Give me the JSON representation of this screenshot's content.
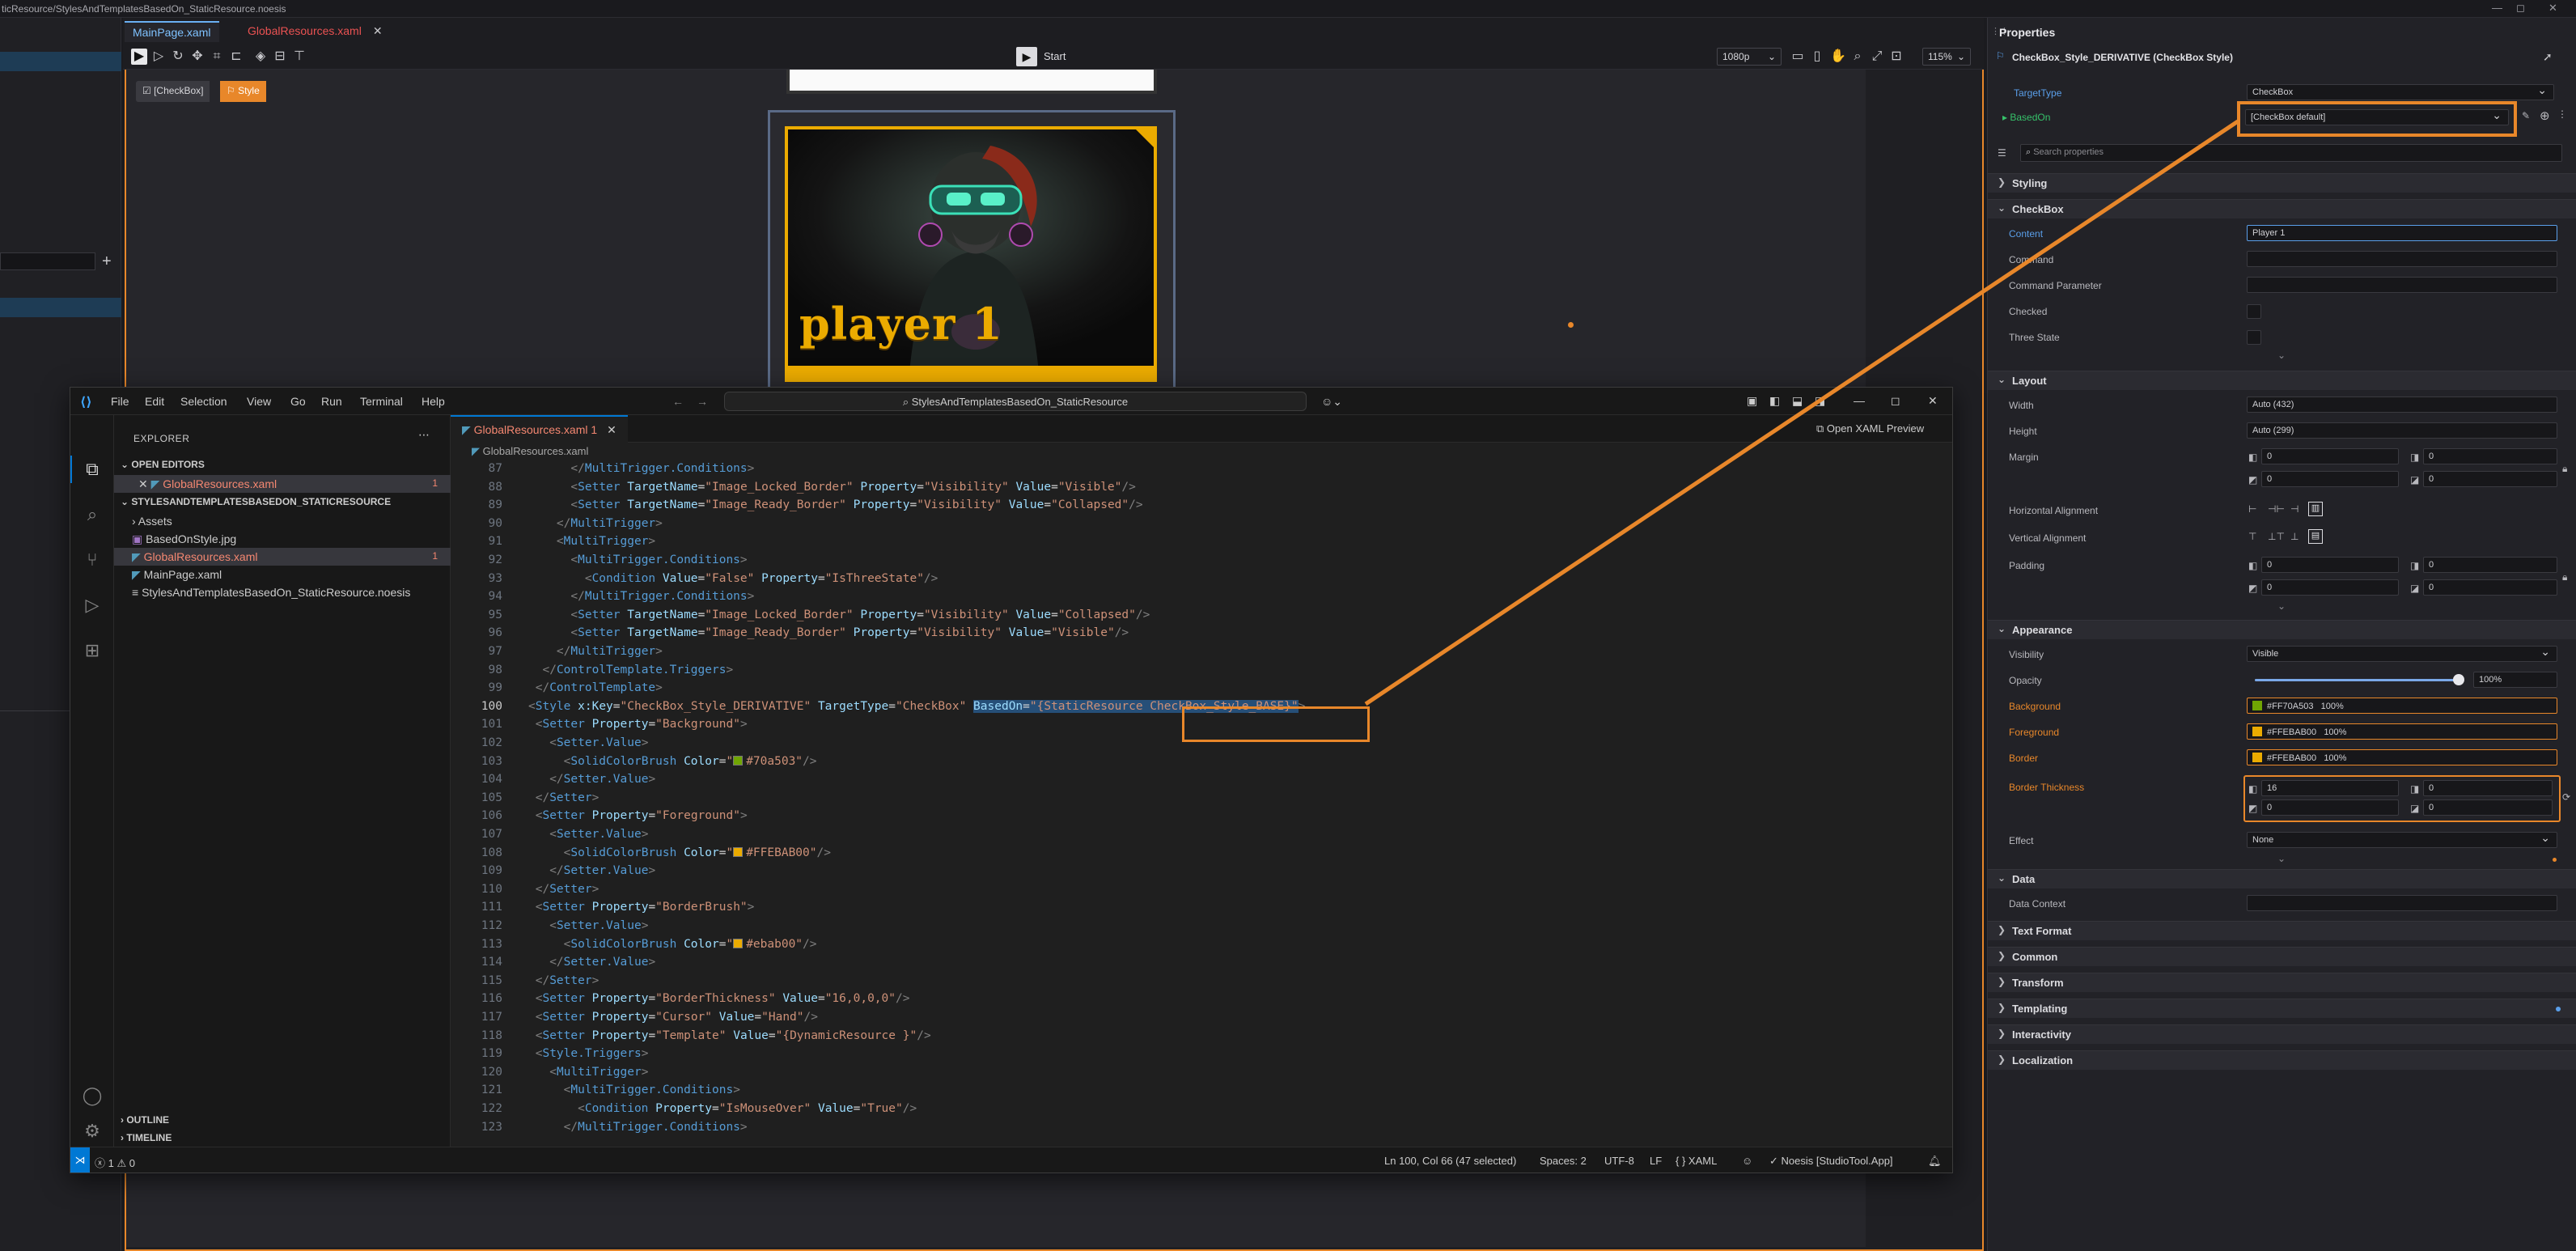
{
  "window": {
    "path": "ticResource/StylesAndTemplatesBasedOn_StaticResource.noesis",
    "controls": [
      "—",
      "◻",
      "✕"
    ]
  },
  "doc_tabs": [
    {
      "label": "MainPage.xaml"
    },
    {
      "label": "GlobalResources.xaml"
    }
  ],
  "designer": {
    "start_label": "Start",
    "resolution": "1080p",
    "zoom": "115%",
    "crumbs": [
      "[CheckBox]",
      "Style"
    ],
    "player_name": "player 1"
  },
  "properties": {
    "header": "Properties",
    "title": "CheckBox_Style_DERIVATIVE (CheckBox Style)",
    "target_type_label": "TargetType",
    "target_type_value": "CheckBox",
    "based_on_label": "BasedOn",
    "based_on_value": "[CheckBox default]",
    "search_placeholder": "Search properties",
    "sections": {
      "styling": "Styling",
      "checkbox": "CheckBox",
      "layout": "Layout",
      "appearance": "Appearance",
      "data": "Data",
      "text_format": "Text Format",
      "common": "Common",
      "transform": "Transform",
      "templating": "Templating",
      "interactivity": "Interactivity",
      "localization": "Localization"
    },
    "checkbox": {
      "content_label": "Content",
      "content_value": "Player 1",
      "command_label": "Command",
      "command_parameter_label": "Command Parameter",
      "checked_label": "Checked",
      "three_state_label": "Three State"
    },
    "layout": {
      "width_label": "Width",
      "width_value": "Auto (432)",
      "height_label": "Height",
      "height_value": "Auto (299)",
      "margin_label": "Margin",
      "margin_values": [
        "0",
        "0",
        "0",
        "0"
      ],
      "halign_label": "Horizontal Alignment",
      "valign_label": "Vertical Alignment",
      "padding_label": "Padding",
      "padding_values": [
        "0",
        "0",
        "0",
        "0"
      ]
    },
    "appearance": {
      "visibility_label": "Visibility",
      "visibility_value": "Visible",
      "opacity_label": "Opacity",
      "opacity_value": "100%",
      "opacity_fraction": 1.0,
      "background_label": "Background",
      "background_value": "#FF70A503",
      "background_pct": "100%",
      "background_color": "#70a503",
      "foreground_label": "Foreground",
      "foreground_value": "#FFEBAB00",
      "foreground_pct": "100%",
      "foreground_color": "#ebab00",
      "border_label": "Border",
      "border_value": "#FFEBAB00",
      "border_pct": "100%",
      "border_color": "#ebab00",
      "border_thickness_label": "Border Thickness",
      "border_thickness_values": [
        "16",
        "0",
        "0",
        "0"
      ],
      "effect_label": "Effect",
      "effect_value": "None"
    },
    "data": {
      "data_context_label": "Data Context"
    }
  },
  "vscode": {
    "menu": [
      "File",
      "Edit",
      "Selection",
      "View",
      "Go",
      "Run",
      "Terminal",
      "Help"
    ],
    "command_center": "StylesAndTemplatesBasedOn_StaticResource",
    "explorer": {
      "header": "EXPLORER",
      "open_editors": "OPEN EDITORS",
      "open_file": "GlobalResources.xaml",
      "open_badge": "1",
      "project": "STYLESANDTEMPLATESBASEDON_STATICRESOURCE",
      "files": [
        {
          "name": "Assets",
          "badge": ""
        },
        {
          "name": "BasedOnStyle.jpg",
          "badge": ""
        },
        {
          "name": "GlobalResources.xaml",
          "badge": "1"
        },
        {
          "name": "MainPage.xaml",
          "badge": ""
        },
        {
          "name": "StylesAndTemplatesBasedOn_StaticResource.noesis",
          "badge": ""
        }
      ],
      "outline": "OUTLINE",
      "timeline": "TIMELINE"
    },
    "editor_tab": "GlobalResources.xaml 1",
    "open_preview": "Open XAML Preview",
    "breadcrumb": "GlobalResources.xaml",
    "code_lines": [
      {
        "n": "87",
        "html": "      <span class='p'>&lt;/</span><span class='t'>MultiTrigger.Conditions</span><span class='p'>&gt;</span>"
      },
      {
        "n": "88",
        "html": "      <span class='p'>&lt;</span><span class='t'>Setter</span> <span class='a'>TargetName</span>=<span class='s'>\"Image_Locked_Border\"</span> <span class='a'>Property</span>=<span class='s'>\"Visibility\"</span> <span class='a'>Value</span>=<span class='s'>\"Visible\"</span><span class='p'>/&gt;</span>"
      },
      {
        "n": "89",
        "html": "      <span class='p'>&lt;</span><span class='t'>Setter</span> <span class='a'>TargetName</span>=<span class='s'>\"Image_Ready_Border\"</span> <span class='a'>Property</span>=<span class='s'>\"Visibility\"</span> <span class='a'>Value</span>=<span class='s'>\"Collapsed\"</span><span class='p'>/&gt;</span>"
      },
      {
        "n": "90",
        "html": "    <span class='p'>&lt;/</span><span class='t'>MultiTrigger</span><span class='p'>&gt;</span>"
      },
      {
        "n": "91",
        "html": "    <span class='p'>&lt;</span><span class='t'>MultiTrigger</span><span class='p'>&gt;</span>"
      },
      {
        "n": "92",
        "html": "      <span class='p'>&lt;</span><span class='t'>MultiTrigger.Conditions</span><span class='p'>&gt;</span>"
      },
      {
        "n": "93",
        "html": "        <span class='p'>&lt;</span><span class='t'>Condition</span> <span class='a'>Value</span>=<span class='s'>\"False\"</span> <span class='a'>Property</span>=<span class='s'>\"IsThreeState\"</span><span class='p'>/&gt;</span>"
      },
      {
        "n": "94",
        "html": "      <span class='p'>&lt;/</span><span class='t'>MultiTrigger.Conditions</span><span class='p'>&gt;</span>"
      },
      {
        "n": "95",
        "html": "      <span class='p'>&lt;</span><span class='t'>Setter</span> <span class='a'>TargetName</span>=<span class='s'>\"Image_Locked_Border\"</span> <span class='a'>Property</span>=<span class='s'>\"Visibility\"</span> <span class='a'>Value</span>=<span class='s'>\"Collapsed\"</span><span class='p'>/&gt;</span>"
      },
      {
        "n": "96",
        "html": "      <span class='p'>&lt;</span><span class='t'>Setter</span> <span class='a'>TargetName</span>=<span class='s'>\"Image_Ready_Border\"</span> <span class='a'>Property</span>=<span class='s'>\"Visibility\"</span> <span class='a'>Value</span>=<span class='s'>\"Visible\"</span><span class='p'>/&gt;</span>"
      },
      {
        "n": "97",
        "html": "    <span class='p'>&lt;/</span><span class='t'>MultiTrigger</span><span class='p'>&gt;</span>"
      },
      {
        "n": "98",
        "html": "  <span class='p'>&lt;/</span><span class='t'>ControlTemplate.Triggers</span><span class='p'>&gt;</span>"
      },
      {
        "n": "99",
        "html": " <span class='p'>&lt;/</span><span class='t'>ControlTemplate</span><span class='p'>&gt;</span>"
      },
      {
        "n": "100",
        "html": "<span class='p'>&lt;</span><span class='t'>Style</span> <span class='a'>x:Key</span>=<span class='s'>\"CheckBox_Style_DERIVATIVE\"</span> <span class='a'>TargetType</span>=<span class='s'>\"CheckBox\"</span> <span class='sel-hl'><span class='a'>BasedOn</span>=<span class='s'>\"{StaticResource CheckBox_Style_BASE}\"</span></span><span class='p'>&gt;</span>"
      },
      {
        "n": "101",
        "html": " <span class='p'>&lt;</span><span class='t'>Setter</span> <span class='a'>Property</span>=<span class='s'>\"Background\"</span><span class='p'>&gt;</span>"
      },
      {
        "n": "102",
        "html": "   <span class='p'>&lt;</span><span class='t'>Setter.Value</span><span class='p'>&gt;</span>"
      },
      {
        "n": "103",
        "html": "     <span class='p'>&lt;</span><span class='t'>SolidColorBrush</span> <span class='a'>Color</span>=<span class='s'>\"<span class='sw' style='background:#70a503'></span>#70a503\"</span><span class='p'>/&gt;</span>"
      },
      {
        "n": "104",
        "html": "   <span class='p'>&lt;/</span><span class='t'>Setter.Value</span><span class='p'>&gt;</span>"
      },
      {
        "n": "105",
        "html": " <span class='p'>&lt;/</span><span class='t'>Setter</span><span class='p'>&gt;</span>"
      },
      {
        "n": "106",
        "html": " <span class='p'>&lt;</span><span class='t'>Setter</span> <span class='a'>Property</span>=<span class='s'>\"Foreground\"</span><span class='p'>&gt;</span>"
      },
      {
        "n": "107",
        "html": "   <span class='p'>&lt;</span><span class='t'>Setter.Value</span><span class='p'>&gt;</span>"
      },
      {
        "n": "108",
        "html": "     <span class='p'>&lt;</span><span class='t'>SolidColorBrush</span> <span class='a'>Color</span>=<span class='s'>\"<span class='sw' style='background:#ebab00'></span>#FFEBAB00\"</span><span class='p'>/&gt;</span>"
      },
      {
        "n": "109",
        "html": "   <span class='p'>&lt;/</span><span class='t'>Setter.Value</span><span class='p'>&gt;</span>"
      },
      {
        "n": "110",
        "html": " <span class='p'>&lt;/</span><span class='t'>Setter</span><span class='p'>&gt;</span>"
      },
      {
        "n": "111",
        "html": " <span class='p'>&lt;</span><span class='t'>Setter</span> <span class='a'>Property</span>=<span class='s'>\"BorderBrush\"</span><span class='p'>&gt;</span>"
      },
      {
        "n": "112",
        "html": "   <span class='p'>&lt;</span><span class='t'>Setter.Value</span><span class='p'>&gt;</span>"
      },
      {
        "n": "113",
        "html": "     <span class='p'>&lt;</span><span class='t'>SolidColorBrush</span> <span class='a'>Color</span>=<span class='s'>\"<span class='sw' style='background:#ebab00'></span>#ebab00\"</span><span class='p'>/&gt;</span>"
      },
      {
        "n": "114",
        "html": "   <span class='p'>&lt;/</span><span class='t'>Setter.Value</span><span class='p'>&gt;</span>"
      },
      {
        "n": "115",
        "html": " <span class='p'>&lt;/</span><span class='t'>Setter</span><span class='p'>&gt;</span>"
      },
      {
        "n": "116",
        "html": " <span class='p'>&lt;</span><span class='t'>Setter</span> <span class='a'>Property</span>=<span class='s'>\"BorderThickness\"</span> <span class='a'>Value</span>=<span class='s'>\"16,0,0,0\"</span><span class='p'>/&gt;</span>"
      },
      {
        "n": "117",
        "html": " <span class='p'>&lt;</span><span class='t'>Setter</span> <span class='a'>Property</span>=<span class='s'>\"Cursor\"</span> <span class='a'>Value</span>=<span class='s'>\"Hand\"</span><span class='p'>/&gt;</span>"
      },
      {
        "n": "118",
        "html": " <span class='p'>&lt;</span><span class='t'>Setter</span> <span class='a'>Property</span>=<span class='s'>\"Template\"</span> <span class='a'>Value</span>=<span class='s'>\"{DynamicResource }\"</span><span class='p'>/&gt;</span>"
      },
      {
        "n": "119",
        "html": " <span class='p'>&lt;</span><span class='t'>Style.Triggers</span><span class='p'>&gt;</span>"
      },
      {
        "n": "120",
        "html": "   <span class='p'>&lt;</span><span class='t'>MultiTrigger</span><span class='p'>&gt;</span>"
      },
      {
        "n": "121",
        "html": "     <span class='p'>&lt;</span><span class='t'>MultiTrigger.Conditions</span><span class='p'>&gt;</span>"
      },
      {
        "n": "122",
        "html": "       <span class='p'>&lt;</span><span class='t'>Condition</span> <span class='a'>Property</span>=<span class='s'>\"IsMouseOver\"</span> <span class='a'>Value</span>=<span class='s'>\"True\"</span><span class='p'>/&gt;</span>"
      },
      {
        "n": "123",
        "html": "     <span class='p'>&lt;/</span><span class='t'>MultiTrigger.Conditions</span><span class='p'>&gt;</span>"
      }
    ],
    "status": {
      "errors": "1",
      "warnings": "0",
      "position": "Ln 100, Col 66 (47 selected)",
      "spaces": "Spaces: 2",
      "encoding": "UTF-8",
      "eol": "LF",
      "language": "XAML",
      "extension": "Noesis [StudioTool.App]"
    }
  },
  "colors": {
    "accent_orange": "#e8872a",
    "vscode_blue": "#0078d4",
    "gold": "#ebab00",
    "green": "#70a503"
  }
}
